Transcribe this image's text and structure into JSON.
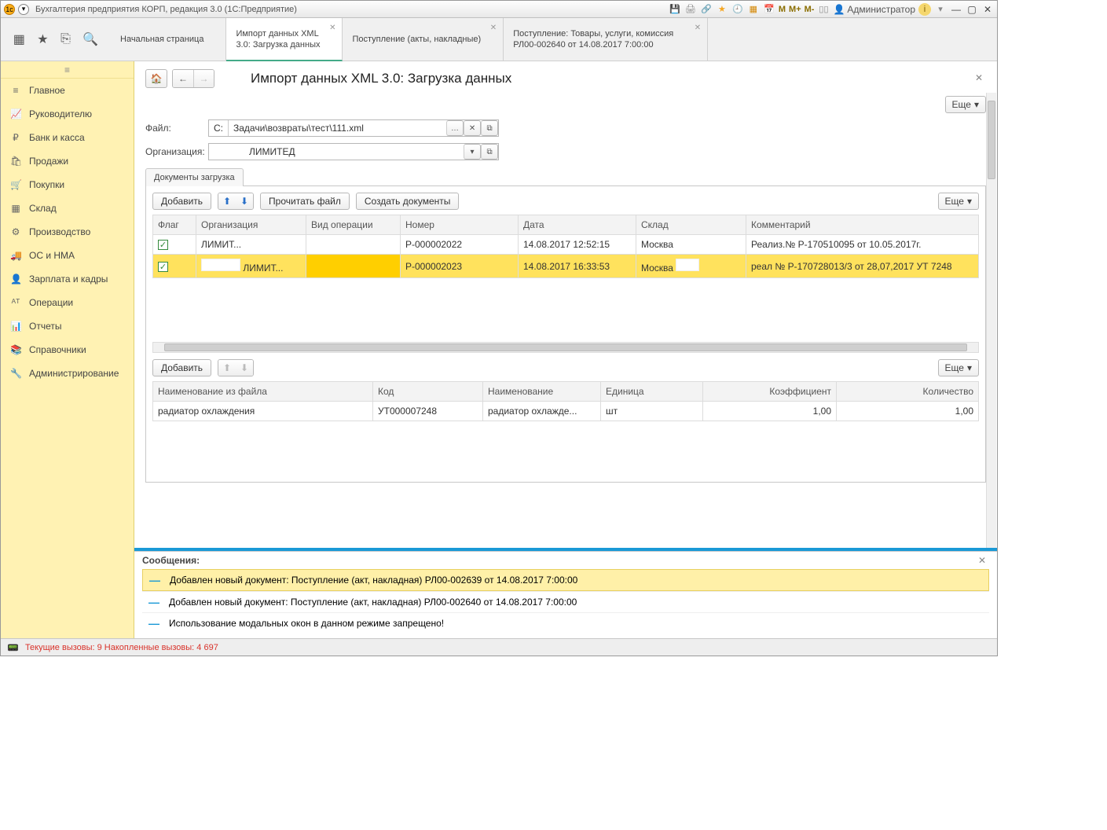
{
  "titlebar": {
    "title": "Бухгалтерия предприятия КОРП, редакция 3.0  (1С:Предприятие)",
    "m": "M",
    "mplus": "M+",
    "mminus": "M-",
    "user": "Администратор"
  },
  "tabs": [
    {
      "l1": "Начальная страница",
      "l2": ""
    },
    {
      "l1": "Импорт данных XML",
      "l2": "3.0: Загрузка данных"
    },
    {
      "l1": "Поступление (акты, накладные)",
      "l2": ""
    },
    {
      "l1": "Поступление: Товары, услуги, комиссия",
      "l2": "РЛ00-002640 от 14.08.2017 7:00:00"
    }
  ],
  "sidebar": [
    {
      "icon": "≡",
      "label": "Главное"
    },
    {
      "icon": "📈",
      "label": "Руководителю"
    },
    {
      "icon": "₽",
      "label": "Банк и касса"
    },
    {
      "icon": "🛍",
      "label": "Продажи"
    },
    {
      "icon": "🛒",
      "label": "Покупки"
    },
    {
      "icon": "▦",
      "label": "Склад"
    },
    {
      "icon": "⚙",
      "label": "Производство"
    },
    {
      "icon": "🚚",
      "label": "ОС и НМА"
    },
    {
      "icon": "👤",
      "label": "Зарплата и кадры"
    },
    {
      "icon": "ᴬᵀ",
      "label": "Операции"
    },
    {
      "icon": "📊",
      "label": "Отчеты"
    },
    {
      "icon": "📚",
      "label": "Справочники"
    },
    {
      "icon": "🔧",
      "label": "Администрирование"
    }
  ],
  "page": {
    "title": "Импорт данных XML 3.0: Загрузка данных",
    "more": "Еще",
    "file_label": "Файл:",
    "file_drive": "C:",
    "file_value": "Задачи\\возвраты\\тест\\111.xml",
    "org_label": "Организация:",
    "org_value": "ЛИМИТЕД",
    "inner_tab": "Документы загрузка",
    "add": "Добавить",
    "read": "Прочитать файл",
    "create": "Создать документы"
  },
  "table1": {
    "cols": [
      "Флаг",
      "Организация",
      "Вид операции",
      "Номер",
      "Дата",
      "Склад",
      "Комментарий"
    ],
    "rows": [
      {
        "flag": true,
        "org": "ЛИМИТ...",
        "op": "",
        "num": "P-000002022",
        "date": "14.08.2017 12:52:15",
        "wh": "Москва",
        "cmt": "Реализ.№ Р-170510095 от 10.05.2017г."
      },
      {
        "flag": true,
        "org": "ЛИМИТ...",
        "op": "",
        "num": "P-000002023",
        "date": "14.08.2017 16:33:53",
        "wh": "Москва",
        "cmt": "реал № Р-170728013/3 от 28,07,2017 УТ 7248"
      }
    ]
  },
  "table2": {
    "cols": [
      "Наименование из файла",
      "Код",
      "Наименование",
      "Единица",
      "Коэффициент",
      "Количество"
    ],
    "rows": [
      {
        "name": "радиатор охлаждения",
        "code": "УТ000007248",
        "name2": "радиатор охлажде...",
        "unit": "шт",
        "coef": "1,00",
        "qty": "1,00"
      }
    ]
  },
  "messages": {
    "title": "Сообщения:",
    "items": [
      "Добавлен новый документ: Поступление (акт, накладная) РЛ00-002639 от 14.08.2017 7:00:00",
      "Добавлен новый документ: Поступление (акт, накладная) РЛ00-002640 от 14.08.2017 7:00:00",
      "Использование модальных окон в данном режиме запрещено!"
    ]
  },
  "status": "Текущие вызовы: 9  Накопленные вызовы: 4 697"
}
